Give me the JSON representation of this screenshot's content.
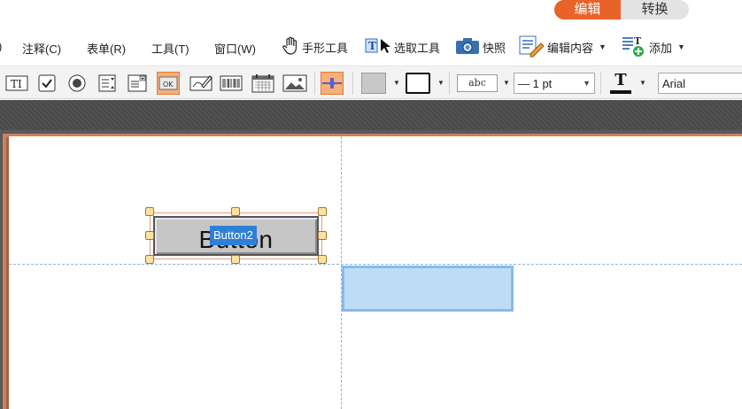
{
  "mode_switch": {
    "edit": "编辑",
    "convert": "转换",
    "active": "edit"
  },
  "menu": {
    "items": [
      "注释(C)",
      "表单(R)",
      "工具(T)",
      "窗口(W)"
    ],
    "tools": {
      "hand": "手形工具",
      "select": "选取工具",
      "snapshot": "快照",
      "edit_content": "编辑内容",
      "add": "添加"
    }
  },
  "form_toolbar": {
    "abc_preview": "abc",
    "line_width": "— 1 pt",
    "font_name": "Arial",
    "ok_label": "OK"
  },
  "canvas": {
    "button_caption": "Button",
    "button_field_name": "Button2"
  },
  "colors": {
    "accent": "#e8632a",
    "selection": "#bfdcf5",
    "guide": "#8fb5dd",
    "name_tag": "#2f7fd6"
  }
}
